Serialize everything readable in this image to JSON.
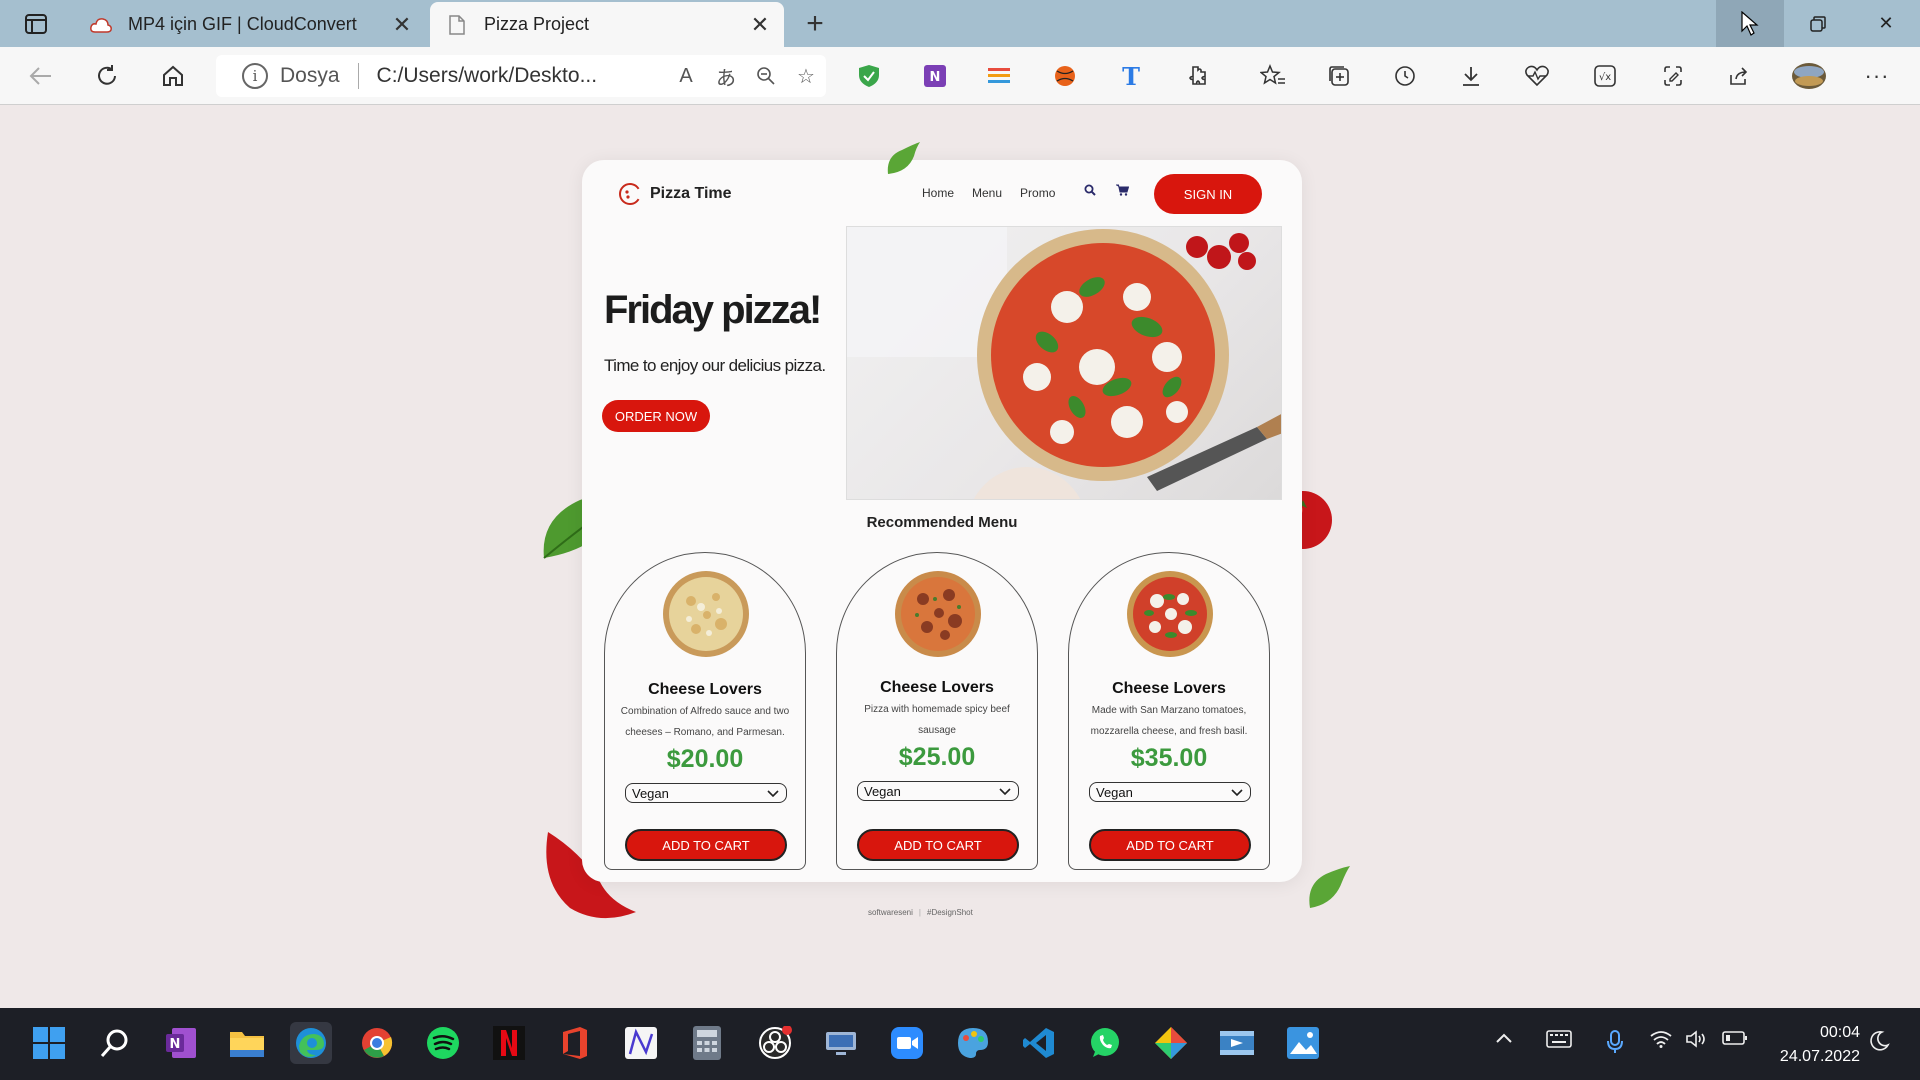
{
  "browser": {
    "tabs": [
      {
        "title": "MP4 için GIF | CloudConvert",
        "active": false
      },
      {
        "title": "Pizza Project",
        "active": true
      }
    ],
    "address": {
      "scheme": "Dosya",
      "url": "C:/Users/work/Deskto..."
    }
  },
  "site": {
    "brand": "Pizza Time",
    "nav": [
      "Home",
      "Menu",
      "Promo"
    ],
    "sign_in": "SIGN IN",
    "hero": {
      "title": "Friday pizza!",
      "subtitle": "Time to enjoy our delicius pizza.",
      "cta": "ORDER NOW"
    },
    "recommended_title": "Recommended Menu",
    "menu": [
      {
        "name": "Cheese Lovers",
        "desc_1": "Combination of Alfredo sauce and two",
        "desc_2": "cheeses – Romano, and Parmesan.",
        "price": "$20.00",
        "option": "Vegan",
        "cta": "ADD TO CART"
      },
      {
        "name": "Cheese Lovers",
        "desc_1": "Pizza with homemade spicy beef",
        "desc_2": "sausage",
        "price": "$25.00",
        "option": "Vegan",
        "cta": "ADD TO CART"
      },
      {
        "name": "Cheese Lovers",
        "desc_1": "Made with San Marzano tomatoes,",
        "desc_2": "mozzarella cheese, and fresh basil.",
        "price": "$35.00",
        "option": "Vegan",
        "cta": "ADD TO CART"
      }
    ],
    "credits": {
      "left": "softwareseni",
      "right": "#DesignShot"
    }
  },
  "taskbar": {
    "time": "00:04",
    "date": "24.07.2022"
  },
  "colors": {
    "accent": "#d8160d",
    "price": "#3c9a3e",
    "tabbar": "#a5bfcf",
    "taskbar": "#1d1f26"
  }
}
